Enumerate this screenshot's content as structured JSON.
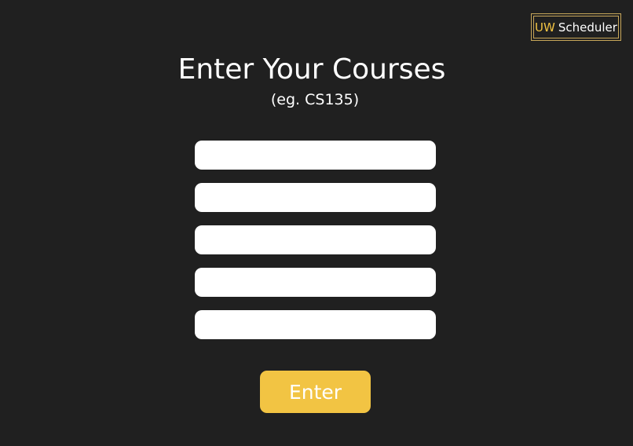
{
  "header": {
    "logo_accent": "UW",
    "logo_rest": "Scheduler"
  },
  "main": {
    "title": "Enter Your Courses",
    "subtitle": "(eg. CS135)",
    "course_inputs": [
      {
        "value": "",
        "placeholder": ""
      },
      {
        "value": "",
        "placeholder": ""
      },
      {
        "value": "",
        "placeholder": ""
      },
      {
        "value": "",
        "placeholder": ""
      },
      {
        "value": "",
        "placeholder": ""
      }
    ],
    "submit_label": "Enter"
  },
  "colors": {
    "background": "#202020",
    "accent": "#f2c443",
    "logo_border": "#c8a75a",
    "input_background": "#ffffff",
    "text": "#ffffff"
  }
}
